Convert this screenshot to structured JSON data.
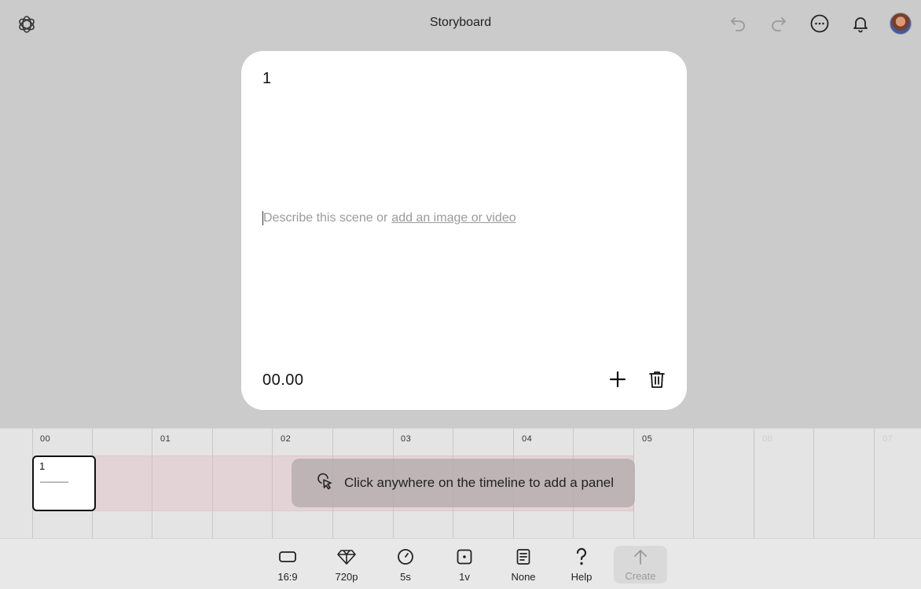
{
  "header": {
    "title": "Storyboard",
    "logo_icon": "openai-logo-icon",
    "actions": [
      {
        "name": "undo",
        "icon": "undo-icon"
      },
      {
        "name": "redo",
        "icon": "redo-icon"
      },
      {
        "name": "more",
        "icon": "more-icon"
      },
      {
        "name": "notifications",
        "icon": "bell-icon"
      },
      {
        "name": "avatar",
        "icon": "user-avatar"
      }
    ]
  },
  "card": {
    "index": "1",
    "placeholder_prefix": "Describe this scene or",
    "placeholder_link": "add an image or video",
    "time": "00.00",
    "add_icon": "plus-icon",
    "delete_icon": "trash-icon"
  },
  "timeline": {
    "ticks": [
      "00",
      "01",
      "02",
      "03",
      "04",
      "05",
      "06",
      "07"
    ],
    "panel_label": "1",
    "hint": "Click anywhere on the timeline to add a panel",
    "hint_icon": "pointer-click-icon"
  },
  "toolbar": {
    "aspect": "16:9",
    "resolution": "720p",
    "duration": "5s",
    "variations": "1v",
    "preset": "None",
    "help": "Help",
    "create": "Create"
  },
  "colors": {
    "background": "#cbcbcb",
    "card": "#ffffff",
    "timeline": "#e4e4e4",
    "track": "#f0d9dd",
    "hint_bg": "#aca6a6"
  }
}
